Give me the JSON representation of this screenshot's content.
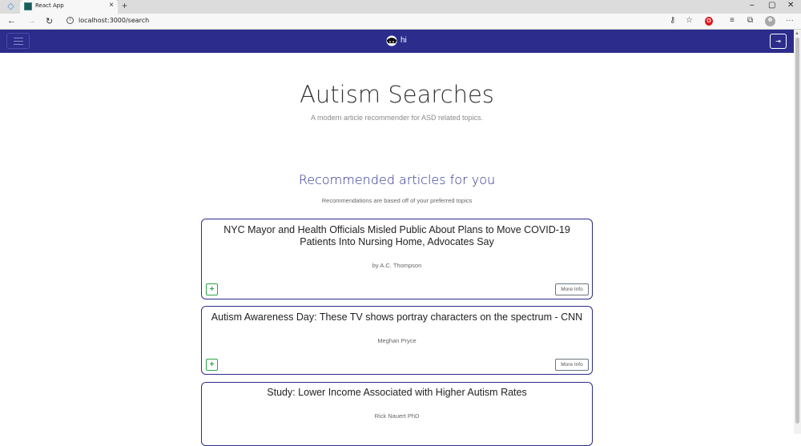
{
  "browser": {
    "tab_title": "React App",
    "tab_close": "×",
    "new_tab": "+",
    "url": "localhost:3000/search",
    "window_controls": [
      "–",
      "▢",
      "✕"
    ],
    "icons": [
      "back-arrow-icon",
      "forward-arrow-icon",
      "reload-icon",
      "site-info-icon",
      "key-icon",
      "favorite-star-icon",
      "opera-icon",
      "favorites-icon",
      "collections-icon",
      "profile-icon",
      "more-icon"
    ]
  },
  "navbar": {
    "brand": "hi",
    "color": "#2b2c8c"
  },
  "hero": {
    "title": "Autism Searches",
    "subtitle": "A modern article recommender for ASD related topics."
  },
  "recommendations": {
    "title": "Recommended articles for you",
    "subtitle": "Recommendations are based off of your preferred topics",
    "more_info_label": "More Info",
    "add_label": "+",
    "articles": [
      {
        "title_line1": "NYC Mayor and Health Officials Misled Public About Plans to Move COVID-19",
        "title_line2": "Patients Into Nursing Home, Advocates Say",
        "author": "by A.C. Thompson"
      },
      {
        "title_line1": "Autism Awareness Day: These TV shows portray characters on the spectrum - CNN",
        "author": "Meghan Pryce"
      },
      {
        "title_line1": "Study: Lower Income Associated with Higher Autism Rates",
        "author": "Rick Nauert PhD"
      }
    ]
  },
  "colors": {
    "accent": "#2b2c8c",
    "add_button": "#28a745",
    "more_button": "#6c757d"
  }
}
